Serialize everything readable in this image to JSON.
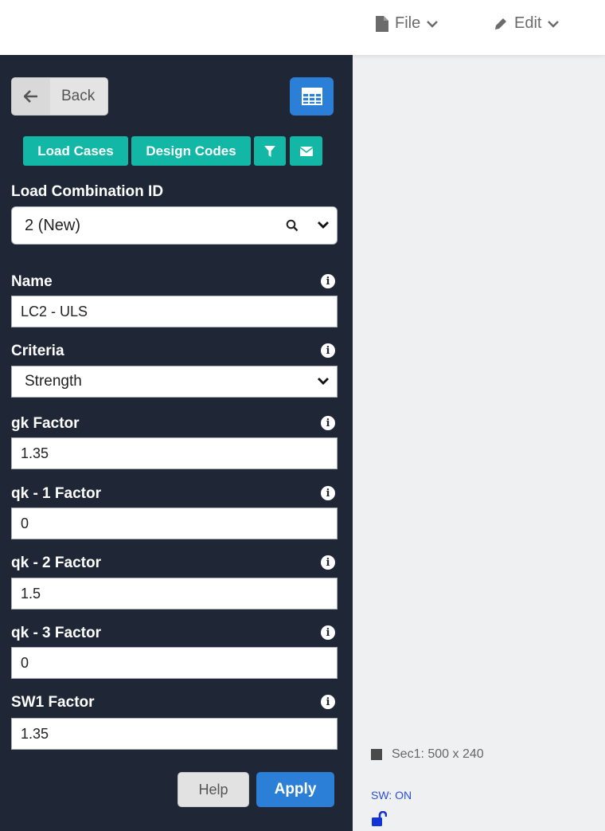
{
  "topbar": {
    "file_label": "File",
    "edit_label": "Edit"
  },
  "sidebar": {
    "back_label": "Back",
    "tabs": {
      "load_cases": "Load Cases",
      "design_codes": "Design Codes"
    },
    "load_combination_id": {
      "label": "Load Combination ID",
      "value": "2 (New)"
    },
    "fields": {
      "name": {
        "label": "Name",
        "value": "LC2 - ULS"
      },
      "criteria": {
        "label": "Criteria",
        "value": "Strength"
      },
      "gk": {
        "label": "gk Factor",
        "value": "1.35"
      },
      "qk1": {
        "label": "qk - 1 Factor",
        "value": "0"
      },
      "qk2": {
        "label": "qk - 2 Factor",
        "value": "1.5"
      },
      "qk3": {
        "label": "qk - 3 Factor",
        "value": "0"
      },
      "sw1": {
        "label": "SW1 Factor",
        "value": "1.35"
      }
    },
    "help_label": "Help",
    "apply_label": "Apply"
  },
  "canvas": {
    "section_label": "Sec1: 500 x 240",
    "sw_status": "SW: ON"
  },
  "colors": {
    "sidebar_bg": "#1f2737",
    "teal": "#12b8a5",
    "blue": "#2b7fd6",
    "canvas_bg": "#eff0f1"
  },
  "icons": [
    "file-icon",
    "chevron-down-icon",
    "pencil-icon",
    "arrow-left-icon",
    "table-icon",
    "filter-icon",
    "envelope-icon",
    "search-icon",
    "info-icon",
    "unlock-icon"
  ]
}
